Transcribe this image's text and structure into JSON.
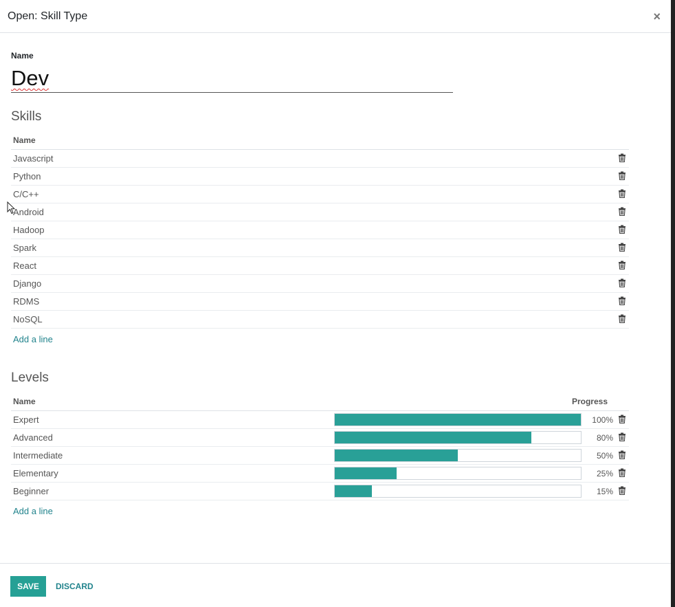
{
  "dialog": {
    "title": "Open: Skill Type",
    "close_symbol": "×"
  },
  "form": {
    "name_label": "Name",
    "name_value": "Dev"
  },
  "skills": {
    "section_title": "Skills",
    "column_name": "Name",
    "rows": [
      {
        "name": "Javascript"
      },
      {
        "name": "Python"
      },
      {
        "name": "C/C++"
      },
      {
        "name": "Android"
      },
      {
        "name": "Hadoop"
      },
      {
        "name": "Spark"
      },
      {
        "name": "React"
      },
      {
        "name": "Django"
      },
      {
        "name": "RDMS"
      },
      {
        "name": "NoSQL"
      }
    ],
    "add_line": "Add a line"
  },
  "levels": {
    "section_title": "Levels",
    "column_name": "Name",
    "column_progress": "Progress",
    "rows": [
      {
        "name": "Expert",
        "progress": 100,
        "progress_label": "100%"
      },
      {
        "name": "Advanced",
        "progress": 80,
        "progress_label": "80%"
      },
      {
        "name": "Intermediate",
        "progress": 50,
        "progress_label": "50%"
      },
      {
        "name": "Elementary",
        "progress": 25,
        "progress_label": "25%"
      },
      {
        "name": "Beginner",
        "progress": 15,
        "progress_label": "15%"
      }
    ],
    "add_line": "Add a line"
  },
  "footer": {
    "save_label": "SAVE",
    "discard_label": "DISCARD"
  },
  "colors": {
    "accent": "#26a095",
    "link": "#21838c"
  },
  "icons": {
    "close": "close-icon",
    "trash": "trash-icon",
    "cursor": "mouse-pointer-icon"
  }
}
